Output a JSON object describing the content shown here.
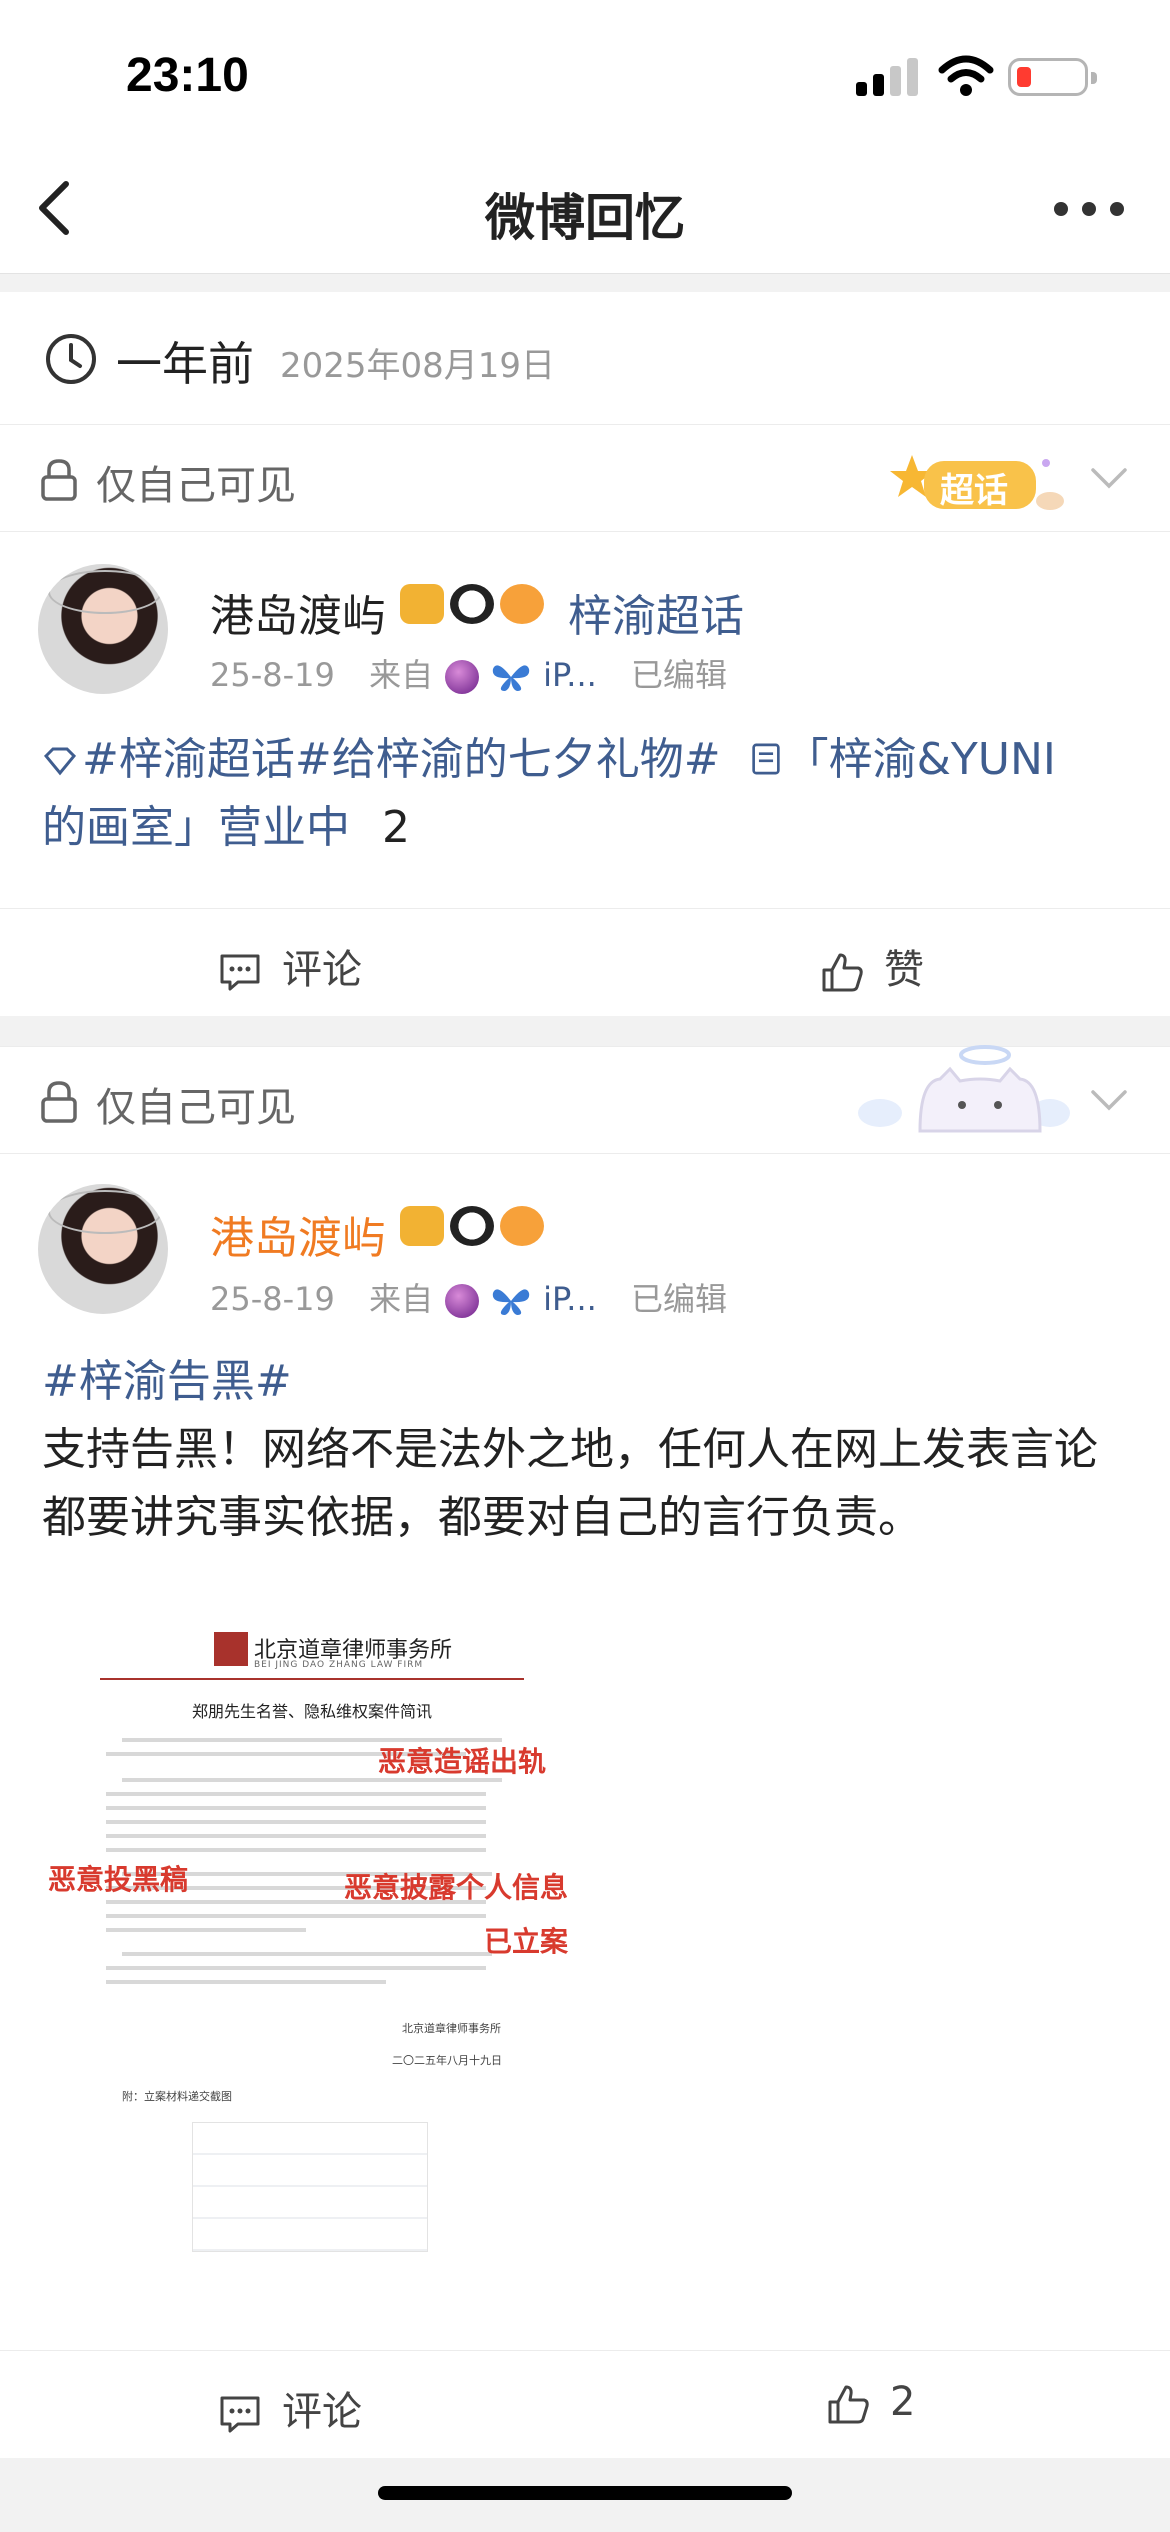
{
  "status": {
    "time": "23:10"
  },
  "nav": {
    "title": "微博回忆"
  },
  "date_header": {
    "relative": "一年前",
    "date": "2025年08月19日"
  },
  "posts": [
    {
      "privacy": "仅自己可见",
      "sticker_text": "超话",
      "author": "港岛渡屿",
      "supertopic": "梓渝超话",
      "date": "25-8-19",
      "source_prefix": "来自",
      "source_suffix": "iP...",
      "edited": "已编辑",
      "text_tag1": "梓渝超话#给梓渝的七夕礼物#",
      "text_link": "「梓渝&YUNI",
      "text_line2": "的画室」营业中",
      "text_count": "2",
      "comment_label": "评论",
      "like_label": "赞"
    },
    {
      "privacy": "仅自己可见",
      "author": "港岛渡屿",
      "date": "25-8-19",
      "source_prefix": "来自",
      "source_suffix": "iP...",
      "edited": "已编辑",
      "hashtag": "#梓渝告黑#",
      "text": "支持告黑！网络不是法外之地，任何人在网上发表言论都要讲究事实依据，都要对自己的言行负责。",
      "doc": {
        "firm": "北京道章律师事务所",
        "firm_en": "BEI JING DAO ZHANG LAW FIRM",
        "heading": "郑朋先生名誉、隐私维权案件简讯",
        "ann1": "恶意造谣出轨",
        "ann2": "恶意投黑稿",
        "ann3": "恶意披露个人信息",
        "ann4": "已立案",
        "sign": "北京道章律师事务所",
        "sign_date": "二〇二五年八月十九日",
        "attach": "附：立案材料递交截图"
      },
      "comment_label": "评论",
      "like_count": "2"
    }
  ]
}
